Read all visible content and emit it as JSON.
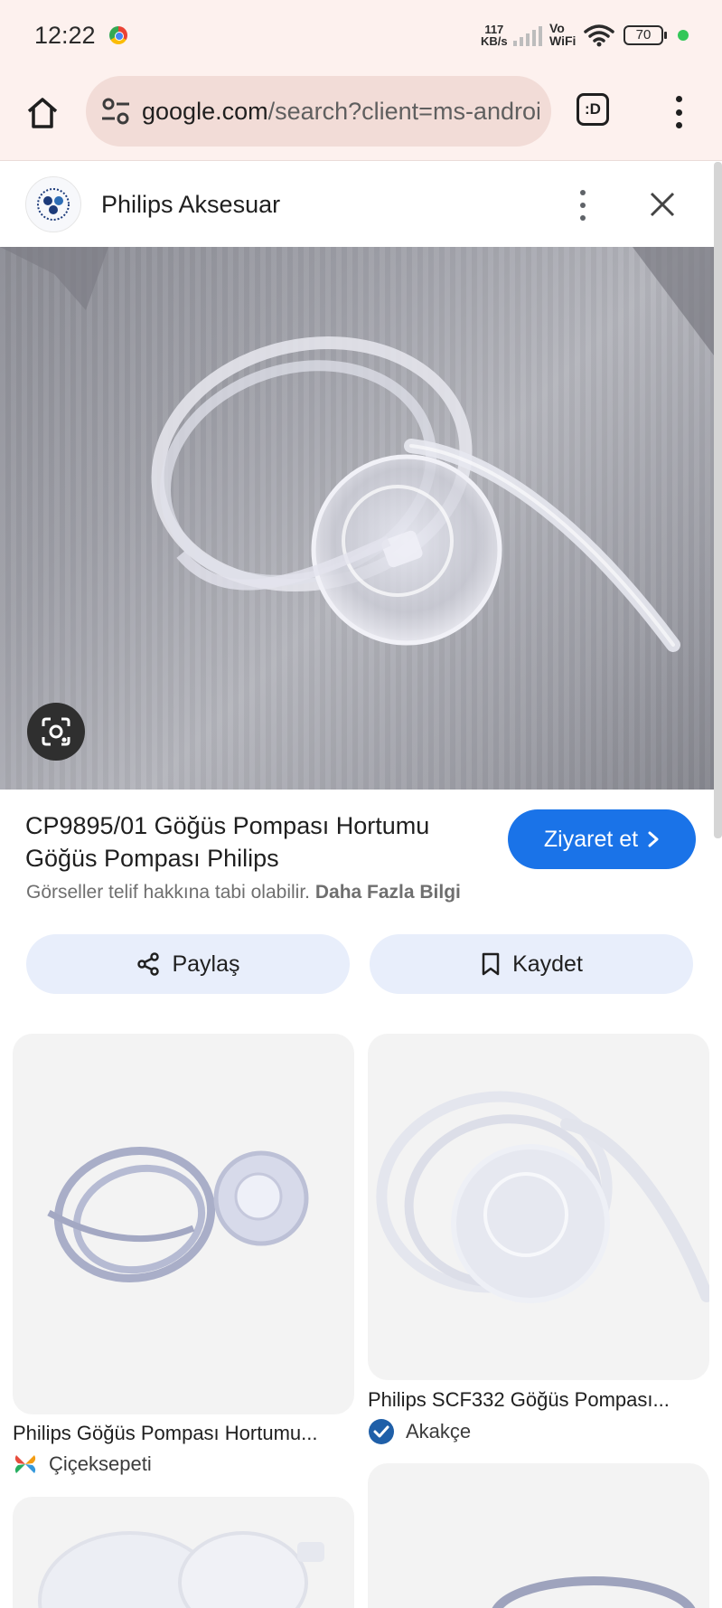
{
  "status_bar": {
    "time": "12:22",
    "net_speed_value": "117",
    "net_speed_unit": "KB/s",
    "vowifi_top": "Vo",
    "vowifi_bottom": "WiFi",
    "battery": "70"
  },
  "browser": {
    "url_host": "google.com",
    "url_path": "/search?client=ms-android",
    "tab_switcher_label": ":D"
  },
  "panel": {
    "source_name": "Philips Aksesuar"
  },
  "result": {
    "title": "CP9895/01 Göğüs Pompası Hortumu Göğüs Pompası Philips",
    "visit_label": "Ziyaret et",
    "copyright_text": "Görseller telif hakkına tabi olabilir.",
    "learn_more": "Daha Fazla Bilgi"
  },
  "actions": {
    "share_label": "Paylaş",
    "save_label": "Kaydet"
  },
  "related": [
    {
      "title": "Philips Göğüs Pompası Hortumu...",
      "source": "Çiçeksepeti"
    },
    {
      "title": "Philips SCF332 Göğüs Pompası...",
      "source": "Akakçe"
    }
  ],
  "icons": {
    "home": "home-icon",
    "site_settings": "tune-icon",
    "tabs": "tab-switcher-icon",
    "menu": "more-vert-icon",
    "close": "close-icon",
    "lens": "google-lens-icon",
    "share": "share-icon",
    "bookmark": "bookmark-icon",
    "verified": "verified-check-icon"
  },
  "colors": {
    "accent": "#1a73e8",
    "chrome_surface": "#fdf1ee",
    "tonal_button": "#e8eefb"
  }
}
